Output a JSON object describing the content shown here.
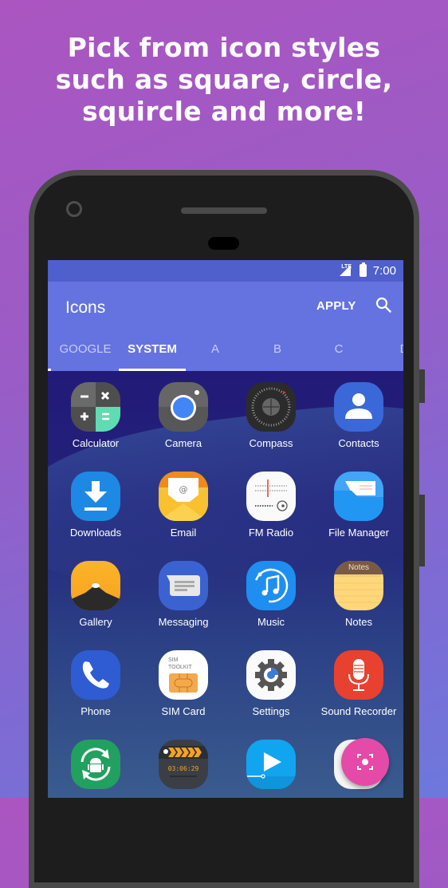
{
  "headline": {
    "lines": [
      "Pick from icon styles",
      "such as square, circle,",
      "squircle and more!"
    ]
  },
  "status_bar": {
    "network": "LTE",
    "time": "7:00"
  },
  "app_bar": {
    "title": "Icons",
    "apply_label": "APPLY",
    "search_icon": "search-icon"
  },
  "tabs": [
    {
      "label": "GOOGLE",
      "active": false
    },
    {
      "label": "SYSTEM",
      "active": true
    },
    {
      "label": "A",
      "active": false
    },
    {
      "label": "B",
      "active": false
    },
    {
      "label": "C",
      "active": false
    },
    {
      "label": "D",
      "active": false
    }
  ],
  "apps": [
    {
      "label": "Calculator",
      "icon": "calculator-icon"
    },
    {
      "label": "Camera",
      "icon": "camera-icon"
    },
    {
      "label": "Compass",
      "icon": "compass-icon"
    },
    {
      "label": "Contacts",
      "icon": "contacts-icon"
    },
    {
      "label": "Downloads",
      "icon": "downloads-icon"
    },
    {
      "label": "Email",
      "icon": "email-icon"
    },
    {
      "label": "FM Radio",
      "icon": "fm-radio-icon"
    },
    {
      "label": "File Manager",
      "icon": "file-manager-icon"
    },
    {
      "label": "Gallery",
      "icon": "gallery-icon"
    },
    {
      "label": "Messaging",
      "icon": "messaging-icon"
    },
    {
      "label": "Music",
      "icon": "music-icon"
    },
    {
      "label": "Notes",
      "icon": "notes-icon",
      "icon_text": "Notes"
    },
    {
      "label": "Phone",
      "icon": "phone-icon"
    },
    {
      "label": "SIM Card",
      "icon": "sim-card-icon",
      "icon_text": [
        "SIM",
        "TOOLKIT"
      ]
    },
    {
      "label": "Settings",
      "icon": "settings-icon"
    },
    {
      "label": "Sound Recorder",
      "icon": "sound-recorder-icon"
    },
    {
      "label": "",
      "icon": "update-center-icon"
    },
    {
      "label": "",
      "icon": "video-editor-icon",
      "icon_text": "03:06:29"
    },
    {
      "label": "",
      "icon": "video-icon"
    },
    {
      "label": "",
      "icon": "voice-search-icon"
    }
  ],
  "fab": {
    "icon": "screenshot-capture-icon"
  },
  "colors": {
    "status_bar": "#4f5fcc",
    "app_bar": "#6573e0",
    "fab": "#e64aa8",
    "phone_body": "#1d1d1d",
    "phone_bezel": "#4a4a4a"
  }
}
